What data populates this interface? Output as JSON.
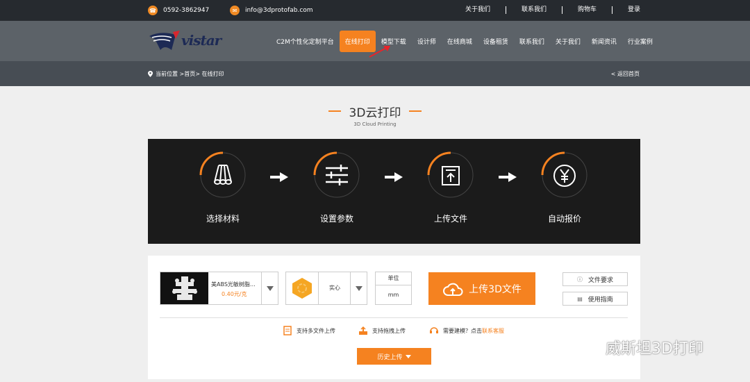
{
  "topbar": {
    "phone": "0592-3862947",
    "email": "info@3dprotofab.com",
    "links": [
      "关于我们",
      "联系我们",
      "购物车",
      "登录"
    ]
  },
  "nav": {
    "logo_text": "vistar",
    "items": [
      "C2M个性化定制平台",
      "在线打印",
      "模型下载",
      "设计师",
      "在线商城",
      "设备租赁",
      "联系我们",
      "关于我们",
      "新闻资讯",
      "行业案例"
    ],
    "active_index": 1
  },
  "breadcrumb": {
    "text": "当前位置 >首页> 在线打印",
    "back": "< 返回首页"
  },
  "heading": {
    "title": "3D云打印",
    "subtitle": "3D Cloud Printing"
  },
  "steps": [
    {
      "label": "选择材料",
      "icon": "materials-icon"
    },
    {
      "label": "设置参数",
      "icon": "sliders-icon"
    },
    {
      "label": "上传文件",
      "icon": "upload-icon"
    },
    {
      "label": "自动报价",
      "icon": "yen-icon"
    }
  ],
  "order": {
    "material_name": "美ABS光敏树脂…",
    "material_price": "0.40元/克",
    "infill_value": "实心",
    "unit_label": "单位",
    "unit_value": "mm",
    "upload_label": "上传3D文件",
    "file_req_label": "文件要求",
    "guide_label": "使用指南",
    "feature_multi": "支持多文件上传",
    "feature_drag": "支持拖拽上传",
    "feature_model_prefix": "需要建模？点击",
    "feature_model_link": "联系客服",
    "history_label": "历史上传"
  },
  "watermark": "威斯坦3D打印",
  "colors": {
    "accent": "#f58220",
    "topbar": "#262a2f",
    "nav": "#5c6268",
    "crumbbar": "#474d54"
  }
}
